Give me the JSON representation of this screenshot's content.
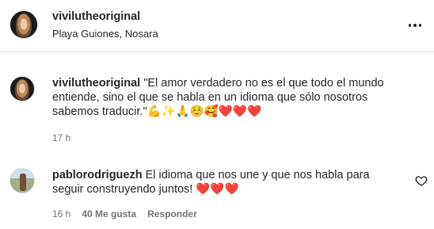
{
  "post": {
    "username": "vivilutheoriginal",
    "location": "Playa Guiones, Nosara"
  },
  "comments": [
    {
      "username": "vivilutheoriginal",
      "text": "\"El amor verdadero no es el que todo el mundo entiende, sino el que se habla en un idioma que sólo nosotros sabemos traducir.\"",
      "emojis": "💪✨🙏☺️🥰❤️❤️❤️",
      "time": "17 h"
    },
    {
      "username": "pablorodriguezh",
      "text": "El idioma que nos une y que nos habla para seguir construyendo juntos!",
      "emojis": "❤️❤️❤️",
      "time": "16 h",
      "likes": "40 Me gusta",
      "reply_label": "Responder"
    }
  ],
  "icons": {
    "more": "more-horizontal-icon",
    "like": "heart-outline-icon"
  }
}
